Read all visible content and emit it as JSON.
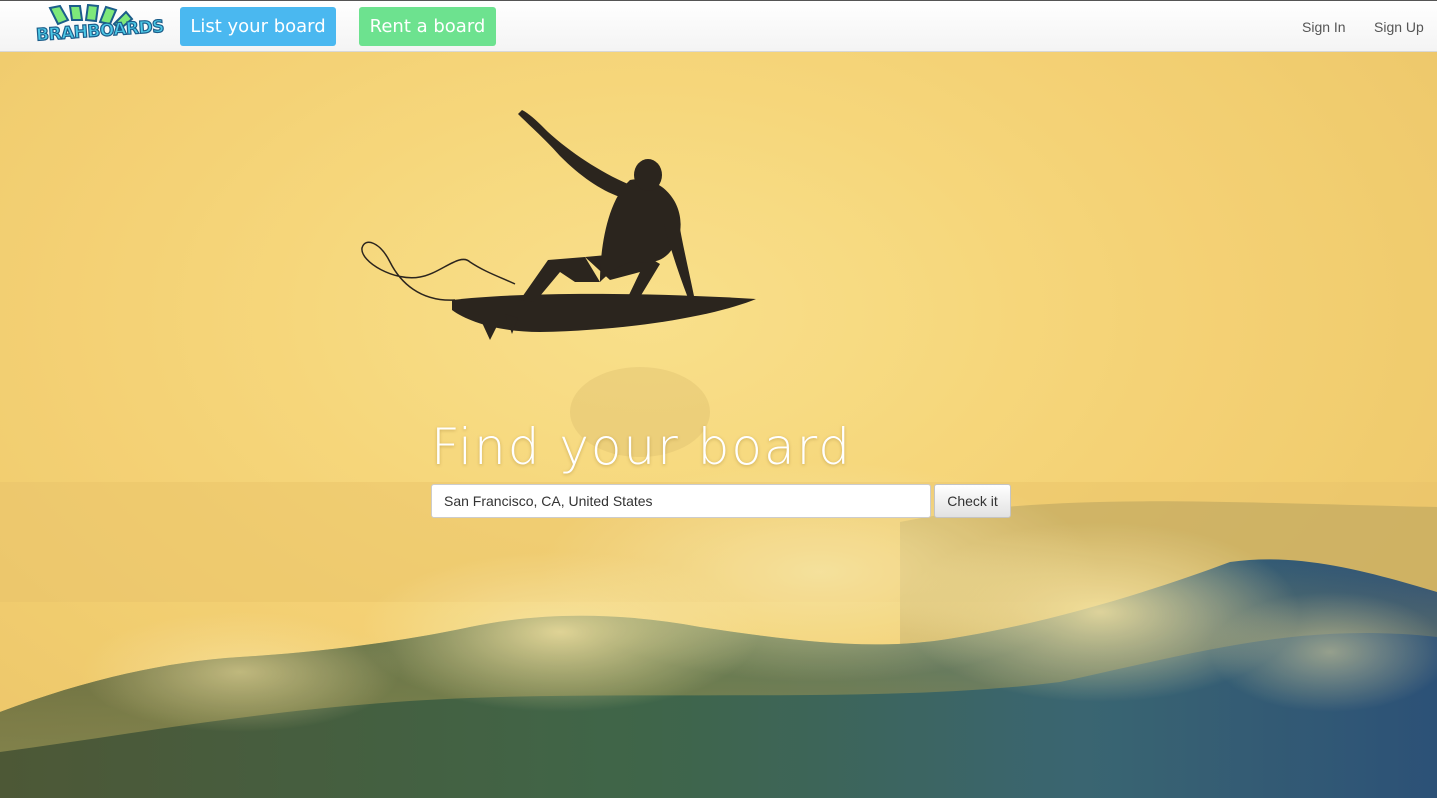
{
  "navbar": {
    "logo_text": "BRAHBOARDS",
    "list_board_label": "List your board",
    "rent_board_label": "Rent a board",
    "sign_in_label": "Sign In",
    "sign_up_label": "Sign Up"
  },
  "hero": {
    "headline": "Find your board",
    "search_value": "San Francisco, CA, United States",
    "check_button_label": "Check it"
  },
  "colors": {
    "list_button": "#4ab8f0",
    "rent_button": "#6de28f",
    "sky": "#f5d271",
    "wave_dark": "#2e4a3a",
    "wave_blue": "#1f4f78"
  }
}
